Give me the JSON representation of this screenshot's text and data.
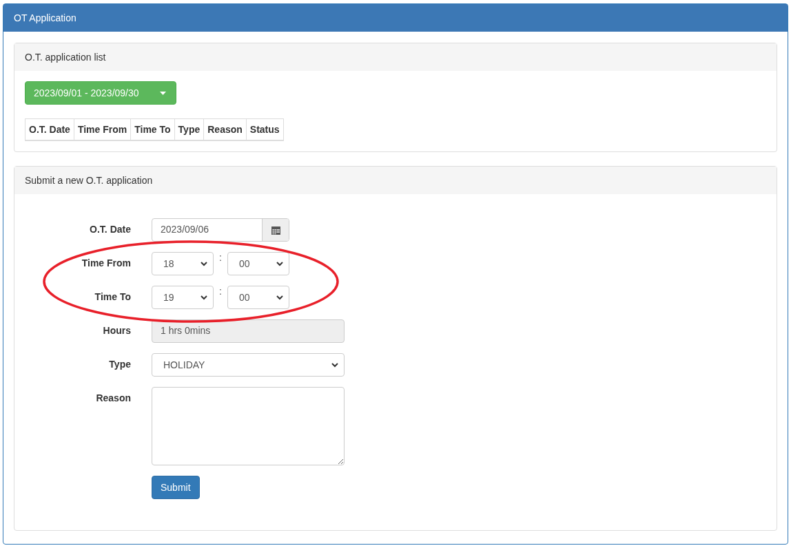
{
  "window": {
    "title": "OT Application"
  },
  "list_panel": {
    "title": "O.T. application list",
    "date_range": "2023/09/01 - 2023/09/30",
    "columns": [
      "O.T. Date",
      "Time From",
      "Time To",
      "Type",
      "Reason",
      "Status"
    ]
  },
  "form_panel": {
    "title": "Submit a new O.T. application",
    "fields": [
      {
        "kind": "date",
        "label": "O.T. Date",
        "value": "2023/09/06"
      },
      {
        "kind": "time",
        "label": "Time From",
        "hour": "18",
        "separator": ":",
        "minute": "00"
      },
      {
        "kind": "time",
        "label": "Time To",
        "hour": "19",
        "separator": ":",
        "minute": "00"
      },
      {
        "kind": "readonly",
        "label": "Hours",
        "value": "1 hrs 0mins"
      },
      {
        "kind": "select",
        "label": "Type",
        "value": "HOLIDAY"
      },
      {
        "kind": "textarea",
        "label": "Reason"
      }
    ],
    "submit": "Submit"
  }
}
